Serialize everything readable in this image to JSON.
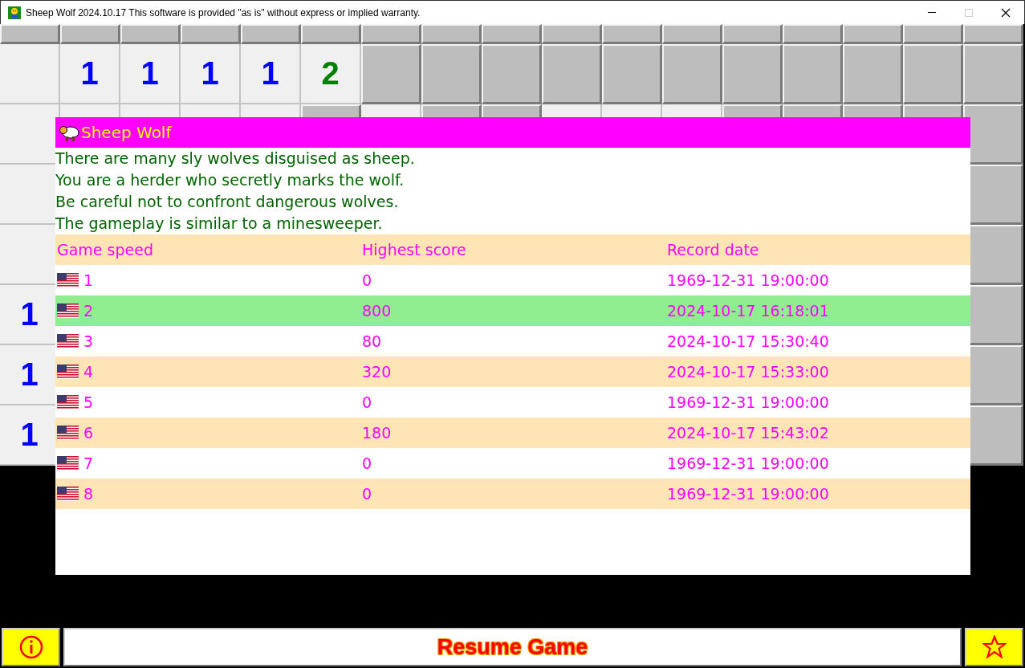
{
  "window": {
    "title": "Sheep Wolf 2024.10.17 This software is provided \"as is\" without express or implied warranty."
  },
  "board": {
    "top_rows": [
      [
        {
          "kind": "hidden"
        },
        {
          "kind": "hidden"
        },
        {
          "kind": "hidden"
        },
        {
          "kind": "hidden"
        },
        {
          "kind": "hidden"
        },
        {
          "kind": "hidden"
        },
        {
          "kind": "hidden"
        },
        {
          "kind": "hidden"
        },
        {
          "kind": "hidden"
        },
        {
          "kind": "hidden"
        },
        {
          "kind": "hidden"
        },
        {
          "kind": "hidden"
        },
        {
          "kind": "hidden"
        },
        {
          "kind": "hidden"
        },
        {
          "kind": "hidden"
        },
        {
          "kind": "hidden"
        },
        {
          "kind": "hidden"
        }
      ],
      [
        {
          "kind": "open"
        },
        {
          "kind": "open",
          "number": "1",
          "color": "#0000ff"
        },
        {
          "kind": "open",
          "number": "1",
          "color": "#0000ff"
        },
        {
          "kind": "open",
          "number": "1",
          "color": "#0000ff"
        },
        {
          "kind": "open",
          "number": "1",
          "color": "#0000ff"
        },
        {
          "kind": "open",
          "number": "2",
          "color": "#008000"
        },
        {
          "kind": "hidden"
        },
        {
          "kind": "hidden"
        },
        {
          "kind": "hidden"
        },
        {
          "kind": "hidden"
        },
        {
          "kind": "hidden"
        },
        {
          "kind": "hidden"
        },
        {
          "kind": "hidden"
        },
        {
          "kind": "hidden"
        },
        {
          "kind": "hidden"
        },
        {
          "kind": "hidden"
        },
        {
          "kind": "hidden"
        }
      ],
      [
        {
          "kind": "open"
        },
        {
          "kind": "open"
        },
        {
          "kind": "open"
        },
        {
          "kind": "open"
        },
        {
          "kind": "open"
        },
        {
          "kind": "hidden"
        },
        {
          "kind": "open"
        },
        {
          "kind": "hidden"
        },
        {
          "kind": "hidden"
        },
        {
          "kind": "open"
        },
        {
          "kind": "open"
        },
        {
          "kind": "open"
        },
        {
          "kind": "hidden"
        },
        {
          "kind": "hidden"
        },
        {
          "kind": "hidden"
        },
        {
          "kind": "hidden"
        },
        {
          "kind": "hidden"
        }
      ]
    ],
    "left_column": [
      {
        "kind": "open"
      },
      {
        "kind": "open"
      },
      {
        "kind": "open",
        "number": "1",
        "color": "#0000ff"
      },
      {
        "kind": "open",
        "number": "1",
        "color": "#0000ff"
      },
      {
        "kind": "open",
        "number": "1",
        "color": "#0000ff"
      }
    ],
    "right_column": [
      {
        "kind": "hidden"
      },
      {
        "kind": "hidden"
      },
      {
        "kind": "hidden"
      },
      {
        "kind": "hidden"
      },
      {
        "kind": "hidden"
      }
    ]
  },
  "dialog": {
    "title": "Sheep Wolf",
    "lines": [
      "There are many sly wolves disguised as sheep.",
      "You are a herder who secretly marks the wolf.",
      "Be careful not to confront dangerous wolves.",
      "The gameplay is similar to a minesweeper."
    ],
    "columns": [
      "Game speed",
      "Highest score",
      "Record date"
    ],
    "rows": [
      {
        "speed": "1",
        "score": "0",
        "date": "1969-12-31 19:00:00",
        "selected": false
      },
      {
        "speed": "2",
        "score": "800",
        "date": "2024-10-17 16:18:01",
        "selected": true
      },
      {
        "speed": "3",
        "score": "80",
        "date": "2024-10-17 15:30:40",
        "selected": false
      },
      {
        "speed": "4",
        "score": "320",
        "date": "2024-10-17 15:33:00",
        "selected": false
      },
      {
        "speed": "5",
        "score": "0",
        "date": "1969-12-31 19:00:00",
        "selected": false
      },
      {
        "speed": "6",
        "score": "180",
        "date": "2024-10-17 15:43:02",
        "selected": false
      },
      {
        "speed": "7",
        "score": "0",
        "date": "1969-12-31 19:00:00",
        "selected": false
      },
      {
        "speed": "8",
        "score": "0",
        "date": "1969-12-31 19:00:00",
        "selected": false
      }
    ]
  },
  "bottom_bar": {
    "resume_label": "Resume Game"
  }
}
